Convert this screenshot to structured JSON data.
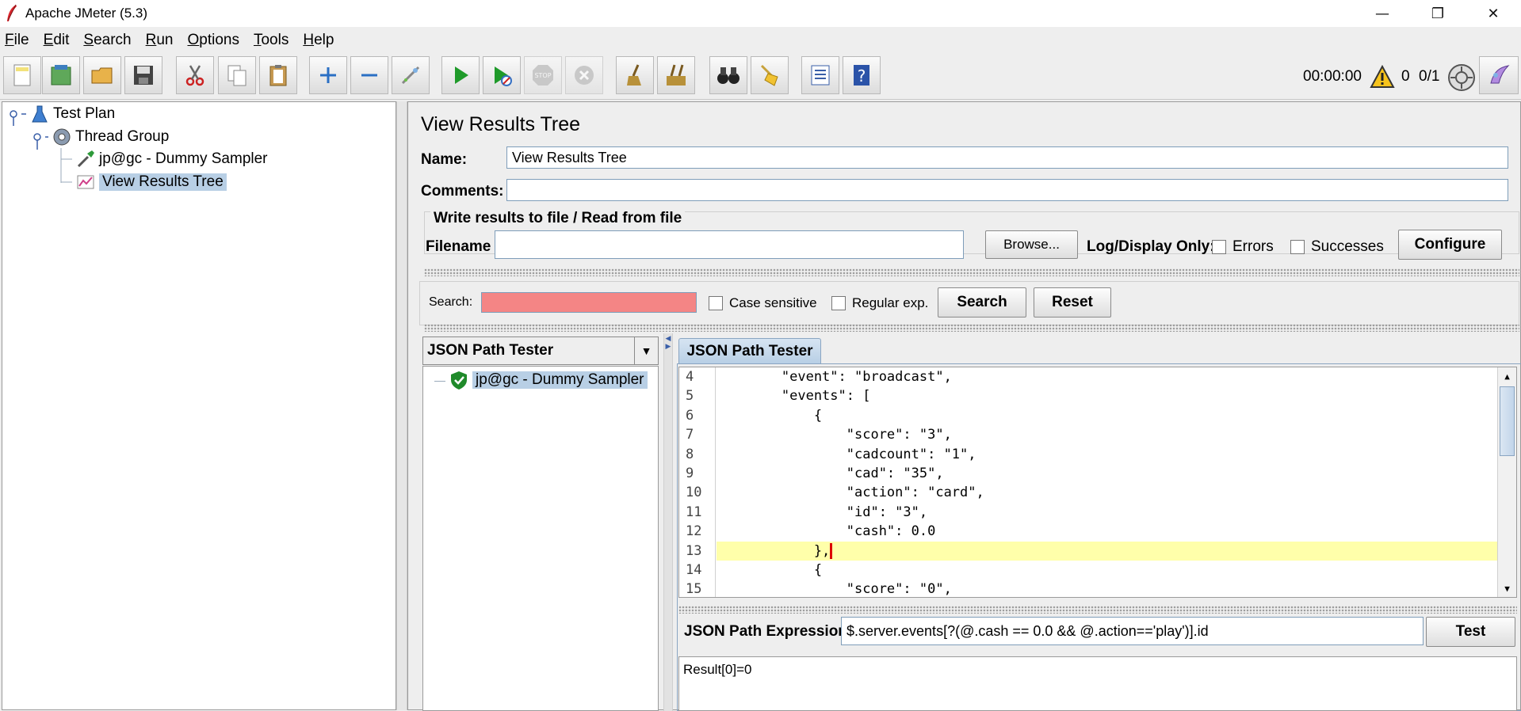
{
  "window": {
    "title": "Apache JMeter (5.3)",
    "minimize": "—",
    "restore": "❐",
    "close": "✕"
  },
  "menu": [
    "File",
    "Edit",
    "Search",
    "Run",
    "Options",
    "Tools",
    "Help"
  ],
  "status": {
    "elapsed": "00:00:00",
    "warnings": "0",
    "threads": "0/1"
  },
  "tree": {
    "test_plan": "Test Plan",
    "thread_group": "Thread Group",
    "sampler": "jp@gc - Dummy Sampler",
    "listener": "View Results Tree"
  },
  "panel": {
    "heading": "View Results Tree",
    "name_label": "Name:",
    "name_value": "View Results Tree",
    "comments_label": "Comments:",
    "comments_value": "",
    "file_section_title": "Write results to file / Read from file",
    "filename_label": "Filename",
    "filename_value": "",
    "browse_label": "Browse...",
    "log_display_label": "Log/Display Only:",
    "errors_label": "Errors",
    "successes_label": "Successes",
    "configure_label": "Configure"
  },
  "search": {
    "label": "Search:",
    "value": "",
    "case_sensitive": "Case sensitive",
    "regular_exp": "Regular exp.",
    "search_button": "Search",
    "reset_button": "Reset"
  },
  "renderer": {
    "selected": "JSON Path Tester",
    "result_item": "jp@gc - Dummy Sampler",
    "tab_label": "JSON Path Tester"
  },
  "code_lines": [
    {
      "n": "4",
      "text": "        \"event\": \"broadcast\","
    },
    {
      "n": "5",
      "text": "        \"events\": ["
    },
    {
      "n": "6",
      "text": "            {"
    },
    {
      "n": "7",
      "text": "                \"score\": \"3\","
    },
    {
      "n": "8",
      "text": "                \"cadcount\": \"1\","
    },
    {
      "n": "9",
      "text": "                \"cad\": \"35\","
    },
    {
      "n": "10",
      "text": "                \"action\": \"card\","
    },
    {
      "n": "11",
      "text": "                \"id\": \"3\","
    },
    {
      "n": "12",
      "text": "                \"cash\": 0.0"
    },
    {
      "n": "13",
      "text": "            },"
    },
    {
      "n": "14",
      "text": "            {"
    },
    {
      "n": "15",
      "text": "                \"score\": \"0\","
    }
  ],
  "jsonpath": {
    "label": "JSON Path Expression",
    "expression": "$.server.events[?(@.cash == 0.0 && @.action=='play')].id",
    "test_button": "Test",
    "result": "Result[0]=0"
  },
  "colors": {
    "search_field_bg": "#f48585",
    "selection_bg": "#b8cfe5",
    "current_line_bg": "#ffffaa"
  }
}
